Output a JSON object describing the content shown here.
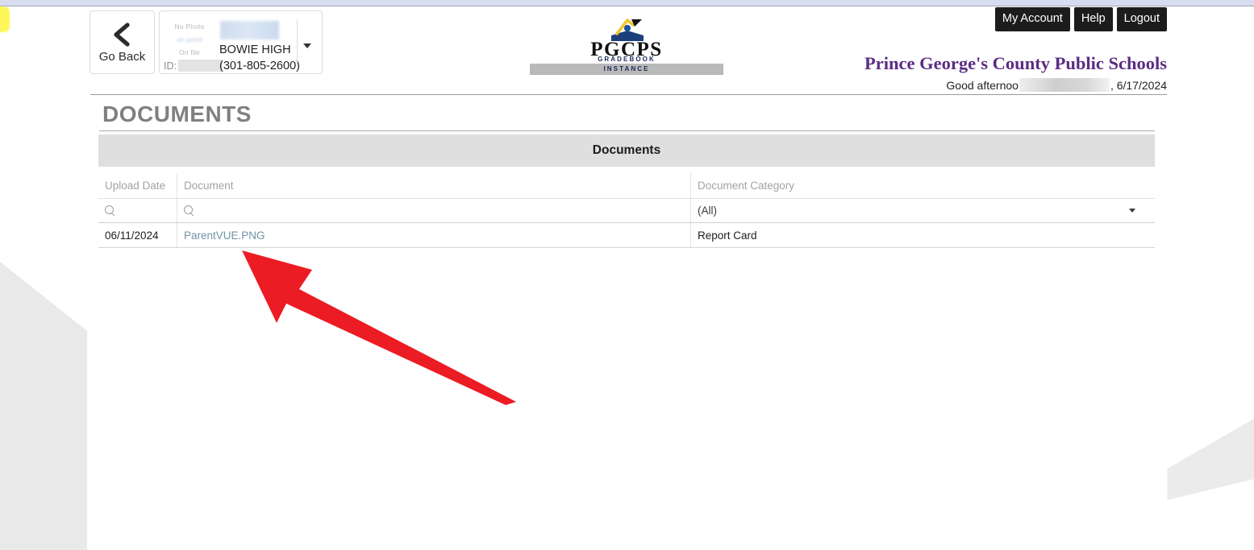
{
  "topbar": {
    "buttons": [
      {
        "label": "My Account",
        "name": "my-account-button"
      },
      {
        "label": "Help",
        "name": "help-button"
      },
      {
        "label": "Logout",
        "name": "logout-button"
      }
    ]
  },
  "go_back": {
    "label": "Go Back",
    "icon": "chevron-left-icon"
  },
  "student_card": {
    "photo_placeholder_line1": "No Photo",
    "photo_placeholder_line2": "on point",
    "photo_placeholder_line3": "On file",
    "id_label": "ID:",
    "id_value": "",
    "student_name": "",
    "school": "BOWIE HIGH",
    "phone": "(301-805-2600)",
    "caret_icon": "chevron-down-icon"
  },
  "logo": {
    "text": "PGCPS",
    "sub_line1": "GRADEBOOK",
    "sub_line2": "INSTANCE",
    "mark_icon": "graduation-cap-book-icon"
  },
  "district": {
    "title": "Prince George's County Public Schools",
    "greeting_prefix": "Good afternoo",
    "greeting_name": "",
    "greeting_suffix": ", 6/17/2024",
    "title_color": "#5b2d83"
  },
  "page": {
    "title": "DOCUMENTS"
  },
  "panel": {
    "title": "Documents"
  },
  "grid": {
    "columns": [
      {
        "key": "upload_date",
        "label": "Upload Date"
      },
      {
        "key": "document",
        "label": "Document"
      },
      {
        "key": "document_category",
        "label": "Document Category"
      }
    ],
    "filters": {
      "upload_date_icon": "search-icon",
      "upload_date_value": "",
      "document_icon": "search-icon",
      "document_value": "",
      "document_category_value": "(All)",
      "document_category_caret": "chevron-down-icon"
    },
    "rows": [
      {
        "upload_date": "06/11/2024",
        "document": "ParentVUE.PNG",
        "document_category": "Report Card"
      }
    ]
  },
  "annotation": {
    "arrow_color": "#ec1c24",
    "arrow_name": "red-pointer-arrow"
  }
}
